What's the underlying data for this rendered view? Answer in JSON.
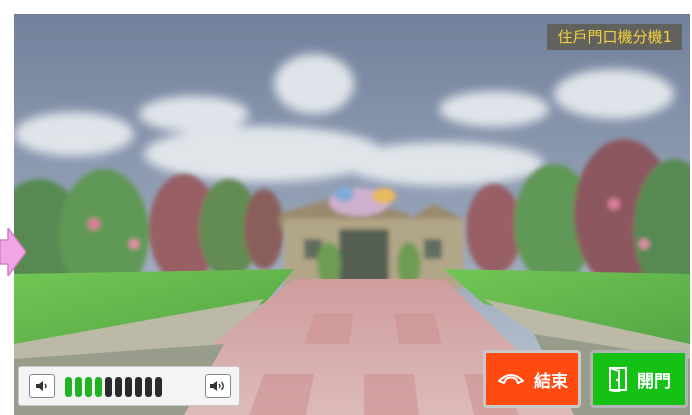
{
  "screen": {
    "station_label": "住戶門口機分機1"
  },
  "volume": {
    "level": 4,
    "max": 10,
    "down_icon": "speaker-low-icon",
    "up_icon": "speaker-high-icon"
  },
  "actions": {
    "end": {
      "label": "結束",
      "icon": "hang-up-icon",
      "color": "#ff4a10"
    },
    "open": {
      "label": "開門",
      "icon": "door-icon",
      "color": "#14c114"
    }
  },
  "indicator": {
    "icon": "right-arrow-icon",
    "color": "#f2a6e6"
  }
}
